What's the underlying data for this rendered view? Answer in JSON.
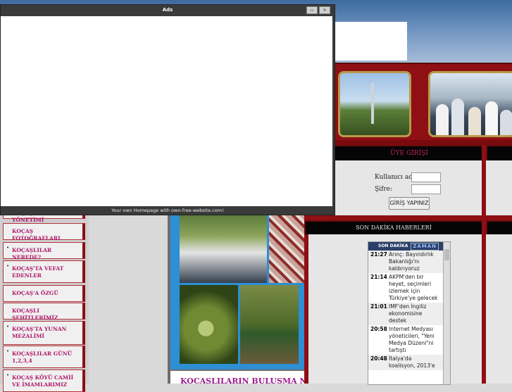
{
  "popup": {
    "title": "Ads",
    "buttons": [
      "▭",
      "✕"
    ],
    "footer": "Your own Homepage with own-free-website.com!"
  },
  "member_login": {
    "header": "ÜYE GİRİŞİ",
    "username_label": "Kullanıcı adı:",
    "password_label": "Şifre:",
    "submit_label": "GİRİŞ YAPINIZ"
  },
  "news": {
    "header": "SON DAKİKA HABERLERİ",
    "widget_title": "SON DAKİKA",
    "widget_brand": "ZAMAN",
    "items": [
      {
        "time": "21:27",
        "text": "Arınç: Bayındırlık Bakanlığı'nı kaldırıyoruz"
      },
      {
        "time": "21:14",
        "text": "AKPM'den bir heyet, seçimleri izlemek için Türkiye'ye gelecek"
      },
      {
        "time": "21:01",
        "text": "IMF'den İngiliz ekonomisine destek"
      },
      {
        "time": "20:58",
        "text": "Internet Medyası yöneticileri, \"Yeni Medya Düzeni\"ni tartıştı"
      },
      {
        "time": "20:48",
        "text": "İtalya'da koalisyon, 2013'e"
      }
    ]
  },
  "sidebar": {
    "items": [
      {
        "label": "KOÇAŞ KÖYÜ YÖNETİMİ"
      },
      {
        "label": "KOÇAŞ FOTOĞRAFLARI"
      },
      {
        "label": "KOÇAŞLILAR NEREDE?"
      },
      {
        "label": "KOÇAŞ'TA VEFAT EDENLER"
      },
      {
        "label": "KOÇAŞ'A ÖZGÜ"
      },
      {
        "label": "KOÇAŞLI ŞEHİTLERİMİZ"
      },
      {
        "label": "KOÇAŞ'TA YUNAN MEZALİMİ"
      },
      {
        "label": "KOÇAŞLILAR GÜNÜ 1,2,3,4"
      },
      {
        "label": "KOÇAŞ KÖYÜ CAMİİ VE İMAMLARIMIZ"
      }
    ]
  },
  "main": {
    "caption": "KOÇAŞLILARIN BULUŞMA NOKTASI"
  },
  "colors": {
    "accent_red": "#8e0f14",
    "link_magenta": "#b0186a",
    "header_black": "#050505",
    "collage_blue": "#2d8fd4"
  }
}
